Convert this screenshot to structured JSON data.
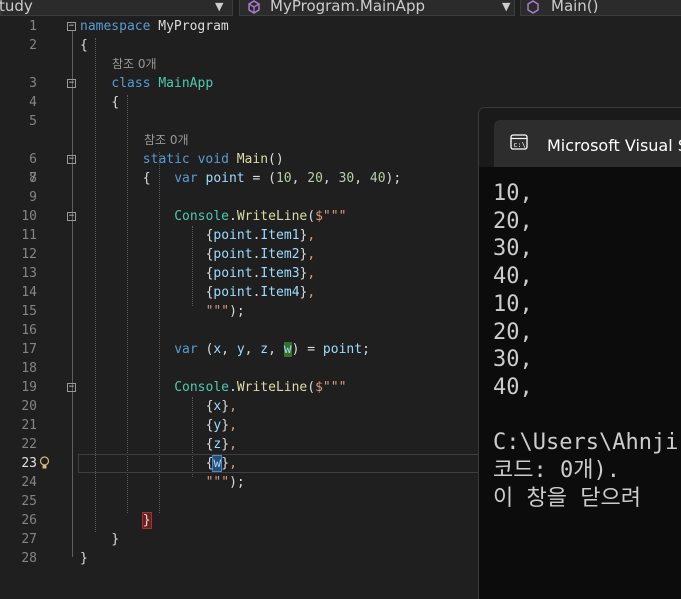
{
  "navbar": {
    "project": "tudy",
    "class_selector": "MyProgram.MainApp",
    "member_selector": "Main()"
  },
  "editor": {
    "reference_lens": "참조 0개",
    "active_line": "23",
    "lines": [
      {
        "n": "1",
        "fold": "−",
        "code": [
          [
            "kw",
            "namespace"
          ],
          [
            "pu",
            " MyProgram"
          ]
        ]
      },
      {
        "n": "2",
        "code": [
          [
            "pu",
            "{"
          ]
        ]
      },
      {
        "n": "3",
        "fold": "−",
        "code": [
          [
            "kw",
            "class"
          ],
          [
            "pu",
            " "
          ],
          [
            "ty",
            "MainApp"
          ]
        ]
      },
      {
        "n": "4",
        "code": [
          [
            "pu",
            "{"
          ]
        ]
      },
      {
        "n": "5",
        "code": []
      },
      {
        "n": "6",
        "fold": "−",
        "code": [
          [
            "kw",
            "static"
          ],
          [
            "pu",
            " "
          ],
          [
            "kw",
            "void"
          ],
          [
            "pu",
            " "
          ],
          [
            "fn",
            "Main"
          ],
          [
            "pu",
            "()"
          ]
        ]
      },
      {
        "n": "7",
        "code": [
          [
            "pu",
            "{"
          ]
        ]
      },
      {
        "n": "8",
        "code": [
          [
            "kw",
            "var"
          ],
          [
            "pu",
            " "
          ],
          [
            "va",
            "point"
          ],
          [
            "pu",
            " = ("
          ],
          [
            "nu",
            "10"
          ],
          [
            "pu",
            ", "
          ],
          [
            "nu",
            "20"
          ],
          [
            "pu",
            ", "
          ],
          [
            "nu",
            "30"
          ],
          [
            "pu",
            ", "
          ],
          [
            "nu",
            "40"
          ],
          [
            "pu",
            ");"
          ]
        ]
      },
      {
        "n": "9",
        "code": []
      },
      {
        "n": "10",
        "fold": "−",
        "code": [
          [
            "ty",
            "Console"
          ],
          [
            "pu",
            "."
          ],
          [
            "fn",
            "WriteLine"
          ],
          [
            "pu",
            "("
          ],
          [
            "st",
            "$\"\"\""
          ]
        ]
      },
      {
        "n": "11",
        "code": [
          [
            "pu",
            "{"
          ],
          [
            "va",
            "point"
          ],
          [
            "pu",
            "."
          ],
          [
            "va",
            "Item1"
          ],
          [
            "pu",
            "}"
          ],
          [
            "st",
            ","
          ]
        ]
      },
      {
        "n": "12",
        "code": [
          [
            "pu",
            "{"
          ],
          [
            "va",
            "point"
          ],
          [
            "pu",
            "."
          ],
          [
            "va",
            "Item2"
          ],
          [
            "pu",
            "}"
          ],
          [
            "st",
            ","
          ]
        ]
      },
      {
        "n": "13",
        "code": [
          [
            "pu",
            "{"
          ],
          [
            "va",
            "point"
          ],
          [
            "pu",
            "."
          ],
          [
            "va",
            "Item3"
          ],
          [
            "pu",
            "}"
          ],
          [
            "st",
            ","
          ]
        ]
      },
      {
        "n": "14",
        "code": [
          [
            "pu",
            "{"
          ],
          [
            "va",
            "point"
          ],
          [
            "pu",
            "."
          ],
          [
            "va",
            "Item4"
          ],
          [
            "pu",
            "}"
          ],
          [
            "st",
            ","
          ]
        ]
      },
      {
        "n": "15",
        "code": [
          [
            "st",
            "\"\"\""
          ],
          [
            "pu",
            ");"
          ]
        ]
      },
      {
        "n": "16",
        "code": []
      },
      {
        "n": "17",
        "code": [
          [
            "kw",
            "var"
          ],
          [
            "pu",
            " ("
          ],
          [
            "va",
            "x"
          ],
          [
            "pu",
            ", "
          ],
          [
            "va",
            "y"
          ],
          [
            "pu",
            ", "
          ],
          [
            "va",
            "z"
          ],
          [
            "pu",
            ", "
          ],
          [
            "hl-w",
            "w"
          ],
          [
            "pu",
            ") = "
          ],
          [
            "va",
            "point"
          ],
          [
            "pu",
            ";"
          ]
        ]
      },
      {
        "n": "18",
        "code": []
      },
      {
        "n": "19",
        "fold": "−",
        "code": [
          [
            "ty",
            "Console"
          ],
          [
            "pu",
            "."
          ],
          [
            "fn",
            "WriteLine"
          ],
          [
            "pu",
            "("
          ],
          [
            "st",
            "$\"\"\""
          ]
        ]
      },
      {
        "n": "20",
        "code": [
          [
            "pu",
            "{"
          ],
          [
            "va",
            "x"
          ],
          [
            "pu",
            "}"
          ],
          [
            "st",
            ","
          ]
        ]
      },
      {
        "n": "21",
        "code": [
          [
            "pu",
            "{"
          ],
          [
            "va",
            "y"
          ],
          [
            "pu",
            "}"
          ],
          [
            "st",
            ","
          ]
        ]
      },
      {
        "n": "22",
        "code": [
          [
            "pu",
            "{"
          ],
          [
            "va",
            "z"
          ],
          [
            "pu",
            "}"
          ],
          [
            "st",
            ","
          ]
        ]
      },
      {
        "n": "23",
        "code": [
          [
            "pu",
            "{"
          ],
          [
            "hl-w2",
            "w"
          ],
          [
            "pu",
            "}"
          ],
          [
            "st",
            ","
          ]
        ]
      },
      {
        "n": "24",
        "code": [
          [
            "st",
            "\"\"\""
          ],
          [
            "pu",
            ");"
          ]
        ]
      },
      {
        "n": "25",
        "code": []
      },
      {
        "n": "26",
        "code": [
          [
            "brace-hl",
            "}"
          ]
        ]
      },
      {
        "n": "27",
        "code": [
          [
            "pu",
            "}"
          ]
        ]
      },
      {
        "n": "28",
        "code": [
          [
            "pu",
            "}"
          ]
        ]
      }
    ]
  },
  "terminal": {
    "title": "Microsoft Visual Studio 디버그 콘솔",
    "output": [
      "10,",
      "20,",
      "30,",
      "40,",
      "10,",
      "20,",
      "30,",
      "40,",
      "",
      "C:\\Users\\Ahnji",
      "코드: 0개).",
      "이 창을 닫으려"
    ]
  },
  "colors": {
    "editor_bg": "#1f1f1f",
    "keyword": "#569cd6",
    "type": "#4ec9b0",
    "method": "#dcdcaa",
    "variable": "#9cdcfe",
    "number": "#b5cea8",
    "string": "#d69d85",
    "terminal_bg": "#0c0c0c"
  },
  "icons": {
    "lightbulb": "lightbulb-icon",
    "console": "console-window-icon",
    "class": "class-icon",
    "dropdown": "chevron-down-icon"
  }
}
